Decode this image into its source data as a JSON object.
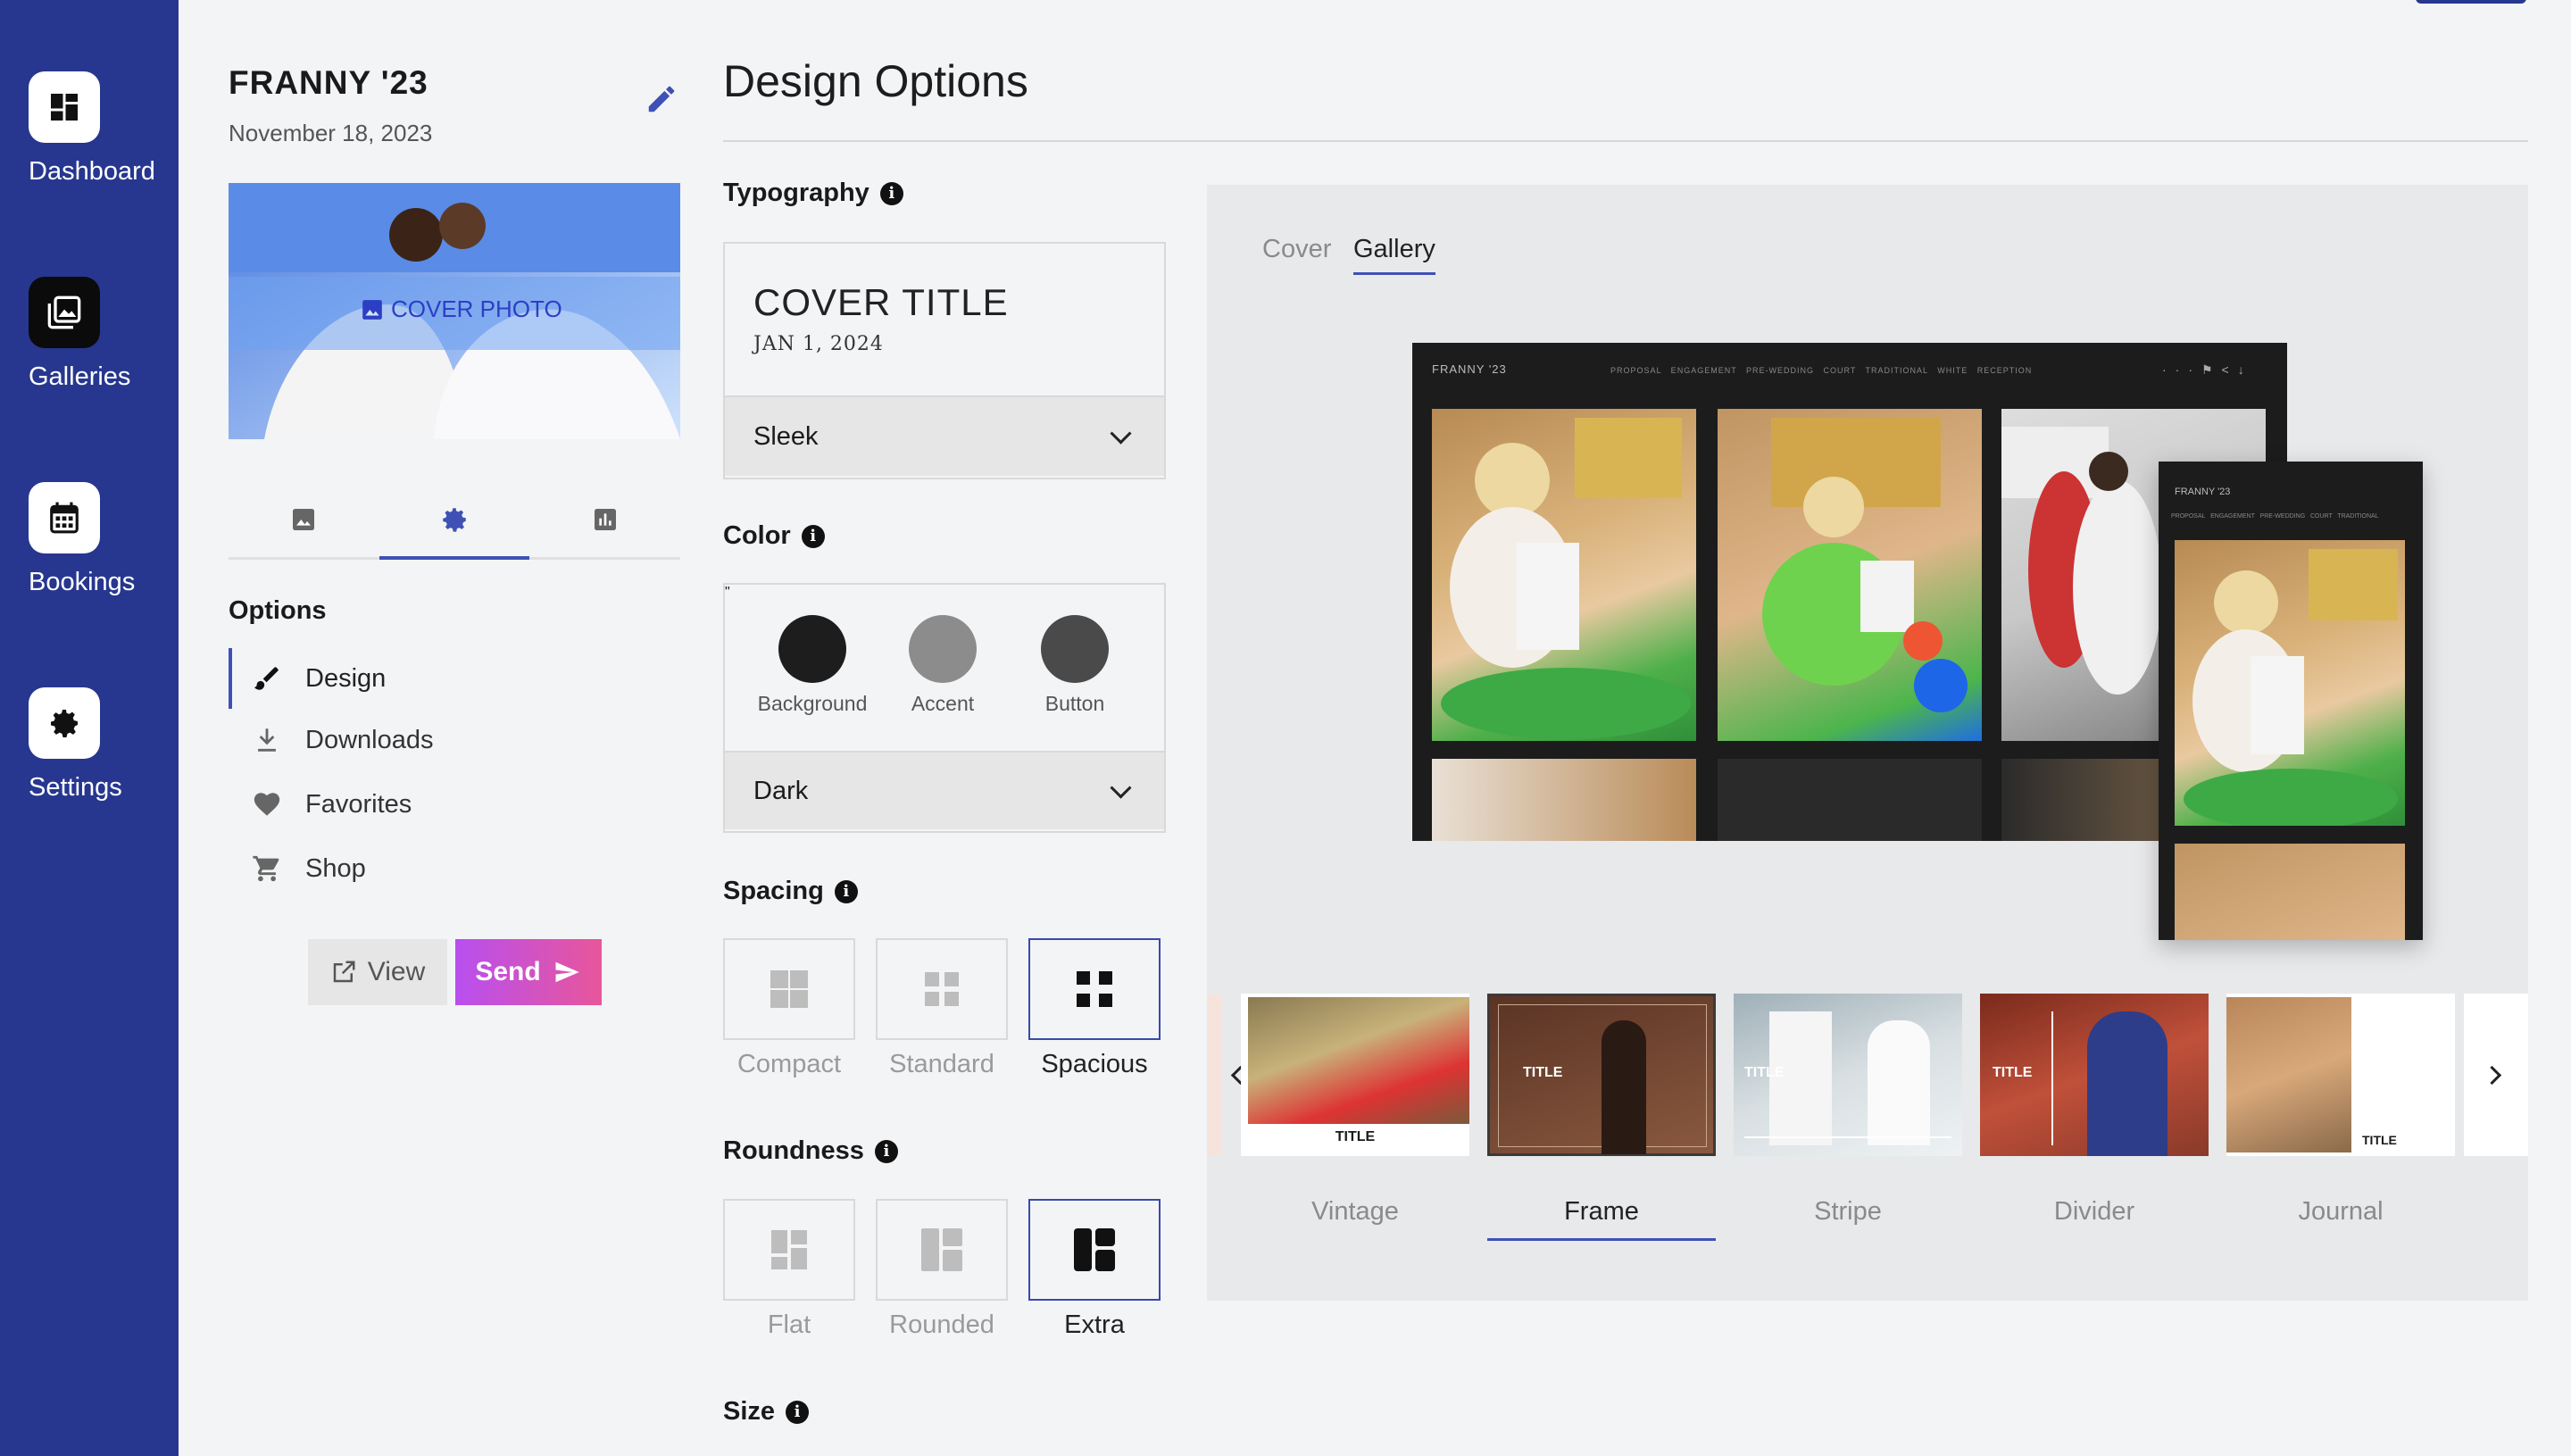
{
  "nav": {
    "items": [
      {
        "label": "Dashboard",
        "icon": "dashboard-icon"
      },
      {
        "label": "Galleries",
        "icon": "galleries-icon",
        "active": true
      },
      {
        "label": "Bookings",
        "icon": "calendar-icon"
      },
      {
        "label": "Settings",
        "icon": "gear-icon"
      }
    ]
  },
  "project": {
    "title": "FRANNY '23",
    "date": "November 18, 2023",
    "cover_label": "COVER PHOTO"
  },
  "options": {
    "heading": "Options",
    "items": [
      "Design",
      "Downloads",
      "Favorites",
      "Shop"
    ]
  },
  "actions": {
    "view": "View",
    "send": "Send"
  },
  "design": {
    "heading": "Design Options",
    "typography": {
      "label": "Typography",
      "preview_title": "COVER TITLE",
      "preview_date": "JAN 1, 2024",
      "selected": "Sleek"
    },
    "color": {
      "label": "Color",
      "swatches": [
        {
          "name": "Background",
          "hex": "#1d1d1d"
        },
        {
          "name": "Accent",
          "hex": "#8c8c8c"
        },
        {
          "name": "Button",
          "hex": "#4a4a4a"
        }
      ],
      "selected": "Dark"
    },
    "spacing": {
      "label": "Spacing",
      "options": [
        "Compact",
        "Standard",
        "Spacious"
      ],
      "selected": "Spacious"
    },
    "roundness": {
      "label": "Roundness",
      "options": [
        "Flat",
        "Rounded",
        "Extra"
      ],
      "selected": "Extra"
    },
    "size": {
      "label": "Size"
    }
  },
  "preview": {
    "tabs": [
      "Cover",
      "Gallery"
    ],
    "active_tab": "Gallery",
    "desktop": {
      "brand": "FRANNY '23",
      "nav": "PROPOSAL   ENGAGEMENT   PRE-WEDDING   COURT   TRADITIONAL   WHITE   RECEPTION"
    },
    "mobile": {
      "brand": "FRANNY '23",
      "nav": "PROPOSAL   ENGAGEMENT   PRE-WEDDING   COURT   TRADITIONAL"
    },
    "styles": [
      {
        "name": "Vintage",
        "tag": "TITLE"
      },
      {
        "name": "Frame",
        "tag": "TITLE"
      },
      {
        "name": "Stripe",
        "tag": "TITLE"
      },
      {
        "name": "Divider",
        "tag": "TITLE"
      },
      {
        "name": "Journal",
        "tag": "TITLE"
      }
    ],
    "selected_style": "Frame"
  },
  "colors": {
    "rail": "#27378f",
    "accent": "#3f51b5",
    "send_gradient_start": "#b84ff0",
    "send_gradient_end": "#e8569a"
  }
}
